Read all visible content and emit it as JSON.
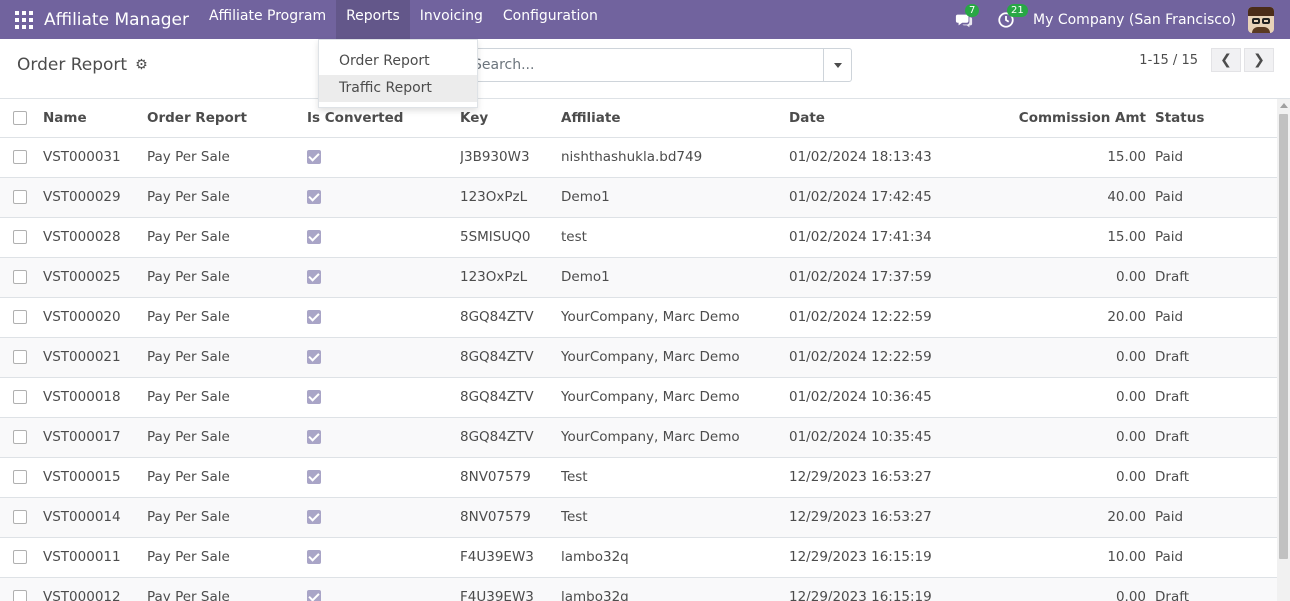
{
  "navbar": {
    "app_title": "Affiliate Manager",
    "menu": [
      {
        "label": "Affiliate Program"
      },
      {
        "label": "Reports"
      },
      {
        "label": "Invoicing"
      },
      {
        "label": "Configuration"
      }
    ],
    "messages_badge": "7",
    "activity_badge": "21",
    "company": "My Company (San Francisco)",
    "accent_color": "#71639e",
    "badge_color": "#28a745"
  },
  "control": {
    "breadcrumb": "Order Report",
    "search_placeholder": "Search...",
    "pager": "1-15 / 15",
    "prev_icon": "chevron-left-icon",
    "next_icon": "chevron-right-icon"
  },
  "dropdown": {
    "items": [
      {
        "label": "Order Report"
      },
      {
        "label": "Traffic Report"
      }
    ]
  },
  "table": {
    "columns": [
      "Name",
      "Order Report",
      "Is Converted",
      "Key",
      "Affiliate",
      "Date",
      "Commission Amt",
      "Status"
    ],
    "rows": [
      {
        "name": "VST000031",
        "order_report": "Pay Per Sale",
        "is_converted": true,
        "key": "J3B930W3",
        "affiliate": "nishthashukla.bd749",
        "date": "01/02/2024 18:13:43",
        "commission": "15.00",
        "status": "Paid"
      },
      {
        "name": "VST000029",
        "order_report": "Pay Per Sale",
        "is_converted": true,
        "key": "123OxPzL",
        "affiliate": "Demo1",
        "date": "01/02/2024 17:42:45",
        "commission": "40.00",
        "status": "Paid"
      },
      {
        "name": "VST000028",
        "order_report": "Pay Per Sale",
        "is_converted": true,
        "key": "5SMISUQ0",
        "affiliate": "test",
        "date": "01/02/2024 17:41:34",
        "commission": "15.00",
        "status": "Paid"
      },
      {
        "name": "VST000025",
        "order_report": "Pay Per Sale",
        "is_converted": true,
        "key": "123OxPzL",
        "affiliate": "Demo1",
        "date": "01/02/2024 17:37:59",
        "commission": "0.00",
        "status": "Draft"
      },
      {
        "name": "VST000020",
        "order_report": "Pay Per Sale",
        "is_converted": true,
        "key": "8GQ84ZTV",
        "affiliate": "YourCompany, Marc Demo",
        "date": "01/02/2024 12:22:59",
        "commission": "20.00",
        "status": "Paid"
      },
      {
        "name": "VST000021",
        "order_report": "Pay Per Sale",
        "is_converted": true,
        "key": "8GQ84ZTV",
        "affiliate": "YourCompany, Marc Demo",
        "date": "01/02/2024 12:22:59",
        "commission": "0.00",
        "status": "Draft"
      },
      {
        "name": "VST000018",
        "order_report": "Pay Per Sale",
        "is_converted": true,
        "key": "8GQ84ZTV",
        "affiliate": "YourCompany, Marc Demo",
        "date": "01/02/2024 10:36:45",
        "commission": "0.00",
        "status": "Draft"
      },
      {
        "name": "VST000017",
        "order_report": "Pay Per Sale",
        "is_converted": true,
        "key": "8GQ84ZTV",
        "affiliate": "YourCompany, Marc Demo",
        "date": "01/02/2024 10:35:45",
        "commission": "0.00",
        "status": "Draft"
      },
      {
        "name": "VST000015",
        "order_report": "Pay Per Sale",
        "is_converted": true,
        "key": "8NV07579",
        "affiliate": "Test",
        "date": "12/29/2023 16:53:27",
        "commission": "0.00",
        "status": "Draft"
      },
      {
        "name": "VST000014",
        "order_report": "Pay Per Sale",
        "is_converted": true,
        "key": "8NV07579",
        "affiliate": "Test",
        "date": "12/29/2023 16:53:27",
        "commission": "20.00",
        "status": "Paid"
      },
      {
        "name": "VST000011",
        "order_report": "Pay Per Sale",
        "is_converted": true,
        "key": "F4U39EW3",
        "affiliate": "lambo32q",
        "date": "12/29/2023 16:15:19",
        "commission": "10.00",
        "status": "Paid"
      },
      {
        "name": "VST000012",
        "order_report": "Pay Per Sale",
        "is_converted": true,
        "key": "F4U39EW3",
        "affiliate": "lambo32q",
        "date": "12/29/2023 16:15:19",
        "commission": "0.00",
        "status": "Draft"
      }
    ]
  }
}
